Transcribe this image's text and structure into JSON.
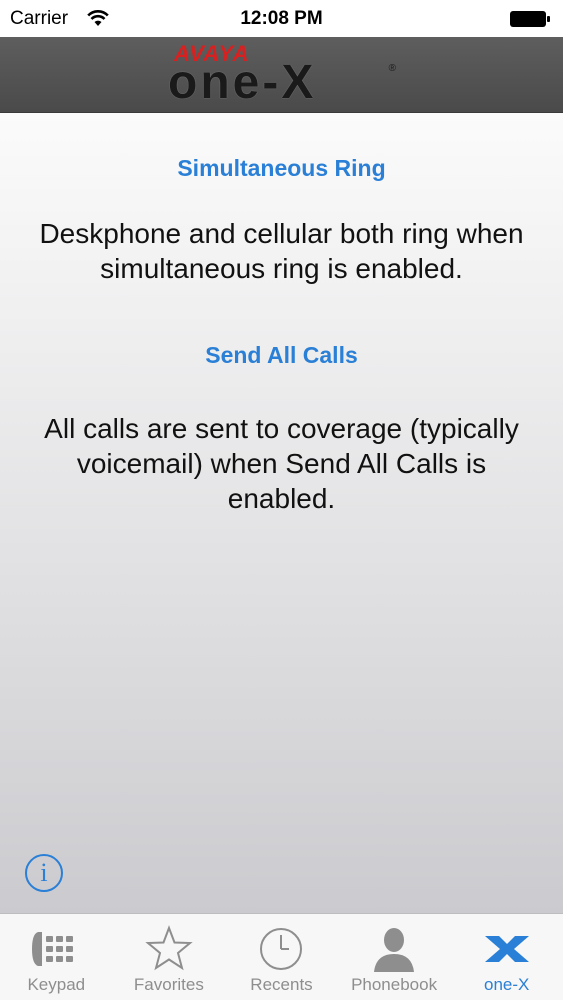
{
  "status_bar": {
    "carrier": "Carrier",
    "time": "12:08 PM"
  },
  "header": {
    "brand_top": "AVAYA",
    "brand_main": "one-X",
    "brand_mark": "®"
  },
  "sections": [
    {
      "title": "Simultaneous Ring",
      "body": "Deskphone and cellular both ring when simultaneous ring is enabled."
    },
    {
      "title": "Send All Calls",
      "body": "All calls are sent to coverage (typically voicemail) when Send All Calls is enabled."
    }
  ],
  "info_button": {
    "label": "i"
  },
  "tabs": [
    {
      "label": "Keypad",
      "icon": "keypad-icon",
      "active": false
    },
    {
      "label": "Favorites",
      "icon": "star-icon",
      "active": false
    },
    {
      "label": "Recents",
      "icon": "clock-icon",
      "active": false
    },
    {
      "label": "Phonebook",
      "icon": "person-icon",
      "active": false
    },
    {
      "label": "one-X",
      "icon": "onex-icon",
      "active": true
    }
  ],
  "colors": {
    "accent": "#2a7fd6",
    "header_bg": "#555555",
    "brand_red": "#d92020",
    "inactive_tab": "#8e8e8e"
  }
}
